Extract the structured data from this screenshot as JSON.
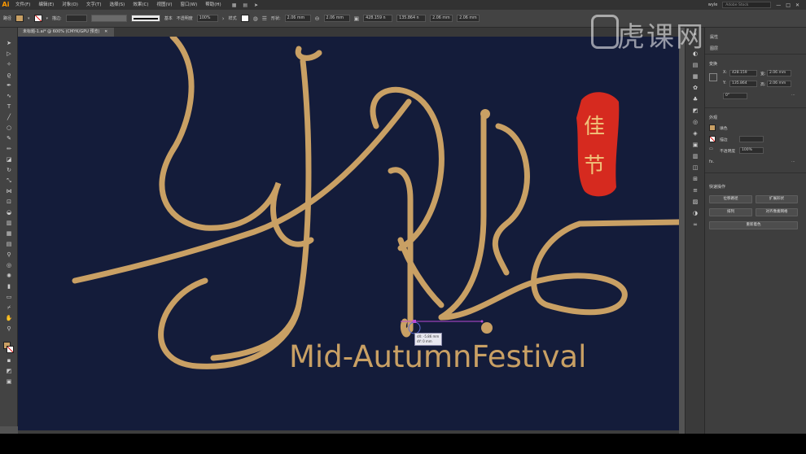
{
  "app": {
    "logo": "Ai"
  },
  "menu": {
    "items": [
      "文件(F)",
      "编辑(E)",
      "对象(O)",
      "文字(T)",
      "选择(S)",
      "效果(C)",
      "视图(V)",
      "窗口(W)",
      "帮助(H)"
    ],
    "workspace": "wyle",
    "search_placeholder": "Adobe Stock",
    "min": "—",
    "max": "□",
    "close": "✕"
  },
  "controlbar": {
    "selection_label": "路径",
    "stroke_label": "描边:",
    "stroke_style": "基本",
    "opacity_label": "不透明度",
    "opacity_value": "100%",
    "style_label": "样式",
    "shape_label": "形状:",
    "shape_w": "2.06 mm",
    "shape_h": "2.06 mm",
    "x_value": "428.159 n",
    "y_value": "135.864 n",
    "w_value": "2.06 mm",
    "h_value": "2.06 mm",
    "colors": {
      "fill": "#c9a064"
    }
  },
  "document": {
    "tab_title": "未标题-1.ai* @ 600% (CMYK/GPU 预览)",
    "close": "✕"
  },
  "canvas": {
    "background": "#141c3a",
    "artwork_color": "#c9a064",
    "seal_color": "#d62a1f",
    "seal_chars": [
      "佳",
      "节"
    ],
    "festival_text": "Mid-AutumnFestival",
    "measure_tip": [
      "dX: -5.86 mm",
      "dY: 0 mm"
    ]
  },
  "panel": {
    "tab_properties": "属性",
    "tab_layers": "图层",
    "tab_libraries": "库",
    "section_transform": "变换",
    "x_label": "X:",
    "x_value": "428.159",
    "y_label": "Y:",
    "y_value": "135.864",
    "w_label": "宽:",
    "w_value": "2.06 mm",
    "h_label": "高:",
    "h_value": "2.06 mm",
    "angle_value": "0°",
    "section_appearance": "外观",
    "fill_label": "填色",
    "stroke_label": "描边",
    "opacity_label": "不透明度",
    "opacity_value": "100%",
    "fx_label": "fx.",
    "section_quick": "快速操作",
    "btn_offset": "位移路径",
    "btn_expand": "扩展形状",
    "btn_arrange": "排列",
    "btn_align": "对齐像素网格",
    "btn_recolor": "重新着色"
  },
  "watermark": {
    "text": "虎课网"
  }
}
